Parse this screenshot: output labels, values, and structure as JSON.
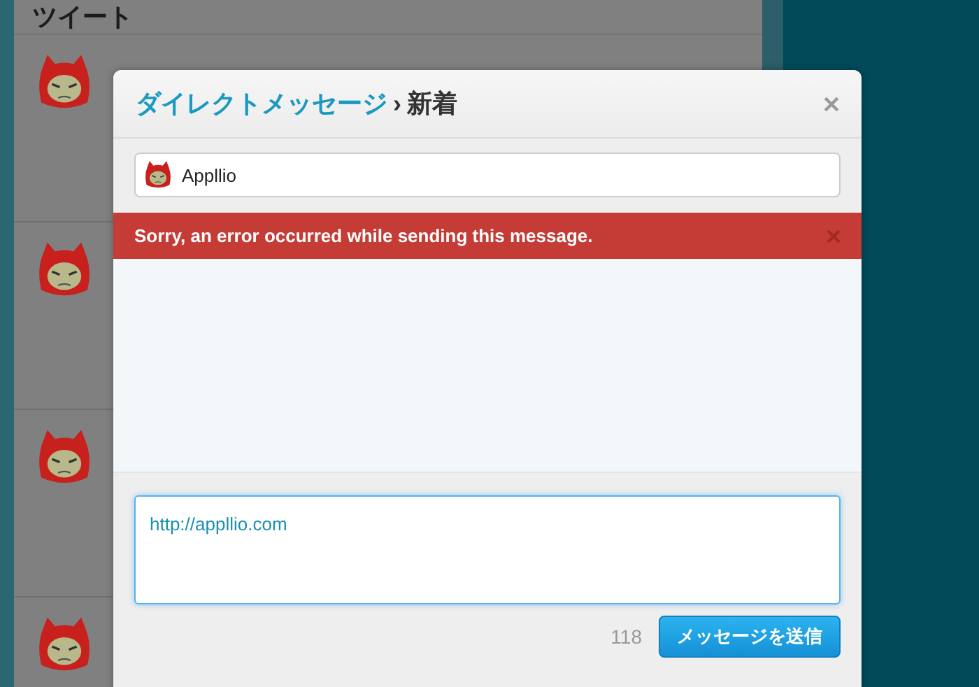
{
  "timeline": {
    "title": "ツイート"
  },
  "dialog": {
    "title_link": "ダイレクトメッセージ",
    "separator": "›",
    "title": "新着",
    "recipient": {
      "name": "Appllio"
    },
    "error": {
      "message": "Sorry, an error occurred while sending this message."
    },
    "composer": {
      "value": "http://appllio.com",
      "focused": true
    },
    "char_count": "118",
    "send_button": "メッセージを送信"
  }
}
